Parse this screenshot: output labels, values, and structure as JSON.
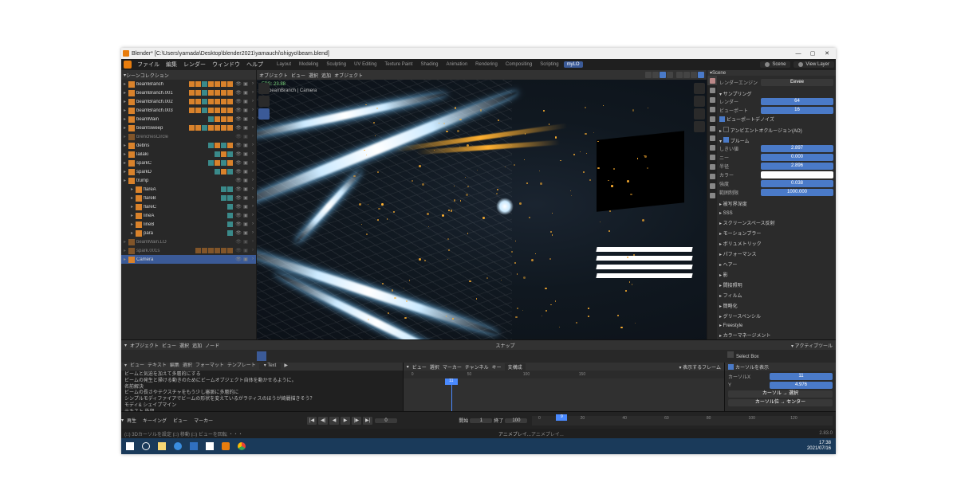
{
  "window": {
    "title": "Blender* [C:\\Users\\yamada\\Desktop\\blender2021\\yamauchi\\shigyo\\beam.blend]",
    "btn_min": "—",
    "btn_max": "▢",
    "btn_close": "✕"
  },
  "menu": {
    "items": [
      "ファイル",
      "編集",
      "レンダー",
      "ウィンドウ",
      "ヘルプ"
    ],
    "workspaces": [
      "Layout",
      "Modeling",
      "Sculpting",
      "UV Editing",
      "Texture Paint",
      "Shading",
      "Animation",
      "Rendering",
      "Compositing",
      "Scripting",
      "myLO"
    ],
    "active_ws": 10,
    "scene": "Scene",
    "viewlayer": "View Layer"
  },
  "outliner": {
    "header": "シーンコレクション",
    "items": [
      {
        "name": "beamBranch",
        "depth": 0,
        "mods": [
          "o",
          "o",
          "t",
          "o",
          "o",
          "o",
          "o"
        ],
        "vis": true
      },
      {
        "name": "beamBranch.001",
        "depth": 0,
        "mods": [
          "o",
          "o",
          "t",
          "o",
          "o",
          "o",
          "o"
        ],
        "vis": true
      },
      {
        "name": "beamBranch.002",
        "depth": 0,
        "mods": [
          "o",
          "o",
          "t",
          "o",
          "o",
          "o",
          "o"
        ],
        "vis": true
      },
      {
        "name": "beamBranch.003",
        "depth": 0,
        "mods": [
          "o",
          "o",
          "t",
          "o",
          "o",
          "o",
          "o"
        ],
        "vis": true
      },
      {
        "name": "beamMain",
        "depth": 0,
        "mods": [
          "t",
          "o",
          "o",
          "o"
        ],
        "vis": true
      },
      {
        "name": "beamSweep",
        "depth": 0,
        "mods": [
          "o",
          "o",
          "t",
          "o",
          "o",
          "o",
          "o"
        ],
        "vis": true
      },
      {
        "name": "brenchesCircle",
        "depth": 0,
        "mods": [],
        "vis": false
      },
      {
        "name": "debris",
        "depth": 0,
        "mods": [
          "t",
          "o",
          "t",
          "o"
        ],
        "vis": true
      },
      {
        "name": "lailaki",
        "depth": 0,
        "mods": [
          "t",
          "o",
          "t"
        ],
        "vis": true
      },
      {
        "name": "sparkC",
        "depth": 0,
        "mods": [
          "t",
          "o",
          "t",
          "o"
        ],
        "vis": true
      },
      {
        "name": "sparkD",
        "depth": 0,
        "mods": [
          "t",
          "o",
          "t"
        ],
        "vis": true
      },
      {
        "name": "trump",
        "depth": 0,
        "mods": [],
        "vis": true
      },
      {
        "name": "flareA",
        "depth": 1,
        "mods": [
          "t",
          "t"
        ],
        "vis": true
      },
      {
        "name": "flareB",
        "depth": 1,
        "mods": [
          "t",
          "t"
        ],
        "vis": true
      },
      {
        "name": "flareC",
        "depth": 1,
        "mods": [
          "t"
        ],
        "vis": true
      },
      {
        "name": "lineA",
        "depth": 1,
        "mods": [
          "t"
        ],
        "vis": true
      },
      {
        "name": "lineB",
        "depth": 1,
        "mods": [
          "t"
        ],
        "vis": true
      },
      {
        "name": "para",
        "depth": 1,
        "mods": [
          "t"
        ],
        "vis": true
      },
      {
        "name": "beamMain.LO",
        "depth": 0,
        "mods": [],
        "vis": false
      },
      {
        "name": "spark.001s",
        "depth": 0,
        "mods": [
          "o",
          "o",
          "o",
          "o",
          "o",
          "o"
        ],
        "vis": false
      },
      {
        "name": "Camera",
        "depth": 0,
        "mods": [],
        "vis": true,
        "sel": true
      }
    ]
  },
  "viewport": {
    "fps": "FPS: 23.88",
    "camera": "(1) beamBranch | Camera",
    "head": [
      "ビュー",
      "選択",
      "追加",
      "オブジェクト"
    ],
    "mode": "オブジェクト"
  },
  "props": {
    "scene": "Scene",
    "engine_label": "レンダーエンジン",
    "engine": "Eevee",
    "sampling": "サンプリング",
    "render_label": "レンダー",
    "render_val": "64",
    "viewport_label": "ビューポート",
    "viewport_val": "16",
    "denoise": "ビューポートデノイズ",
    "ao": "アンビエントオクルージョン(AO)",
    "bloom": "ブルーム",
    "threshold_label": "しきい値",
    "threshold": "2.897",
    "knee_label": "ニー",
    "knee": "0.000",
    "radius_label": "半径",
    "radius": "2.896",
    "color_label": "カラー",
    "intensity_label": "強度",
    "intensity": "0.038",
    "clamp_label": "範囲制限",
    "clamp": "1000.000",
    "sections": [
      "被写界深度",
      "SSS",
      "スクリーンスペース反射",
      "モーションブラー",
      "ボリュメトリック",
      "パフォーマンス",
      "ヘアー",
      "影",
      "間接照明",
      "フィルム",
      "簡略化",
      "グリースペンシル",
      "Freestyle",
      "カラーマネージメント"
    ]
  },
  "nla": {
    "head": [
      "オブジェクト",
      "ビュー",
      "選択",
      "追加",
      "ノード"
    ],
    "tool": "Select Box",
    "tool_section": "アクティブツール",
    "snap": "スナップ"
  },
  "text": {
    "head": [
      "ビュー",
      "テキスト",
      "編集",
      "選択",
      "フォーマット",
      "テンプレート"
    ],
    "doc": "Text",
    "lines": [
      "ビームと気迫を加えて多層的にする",
      "ビームの発生と掃ける動きのためにビームオブジェクト自体を動かせるように。",
      "名前解決",
      "ビームの長さやテクスチャをもう少し審脈に多層的に",
      "シンプルモディファイアでビームの形状を変えているがラティスのほうが綺麗描きそう？",
      "モディ&  シェイプマイン",
      "テキスト 外部"
    ]
  },
  "dope": {
    "head": [
      "ビュー",
      "選択",
      "マーカー",
      "チャンネル",
      "キー"
    ],
    "mode": "支構成",
    "show_label": "表示するフレーム",
    "ticks": [
      "0",
      "50",
      "100",
      "150"
    ],
    "cursor_section": "カーソルを表示",
    "cursor_x_label": "カーソルX",
    "cursor_x": "11",
    "cursor_y_label": "Y",
    "cursor_y": "4.976",
    "cursor_to_sel": "カーソル → 選択",
    "cursor_center": "カーソル位 → センター"
  },
  "timeline": {
    "head": [
      "再生",
      "キーイング",
      "ビュー",
      "マーカー"
    ],
    "frame": "0",
    "start_label": "開始",
    "start": "1",
    "end_label": "終了",
    "end": "100",
    "ticks": [
      "0",
      "20",
      "40",
      "60",
      "80",
      "100",
      "120"
    ],
    "playhead": "9"
  },
  "status": {
    "left": "(□) 3Dカーソルを設定  (□) 移動  (□) ビューを回転  ・・・",
    "anim": "アニメプレイ...",
    "version": "2.83.0"
  },
  "taskbar": {
    "time": "17:38",
    "date": "2021/07/16"
  }
}
